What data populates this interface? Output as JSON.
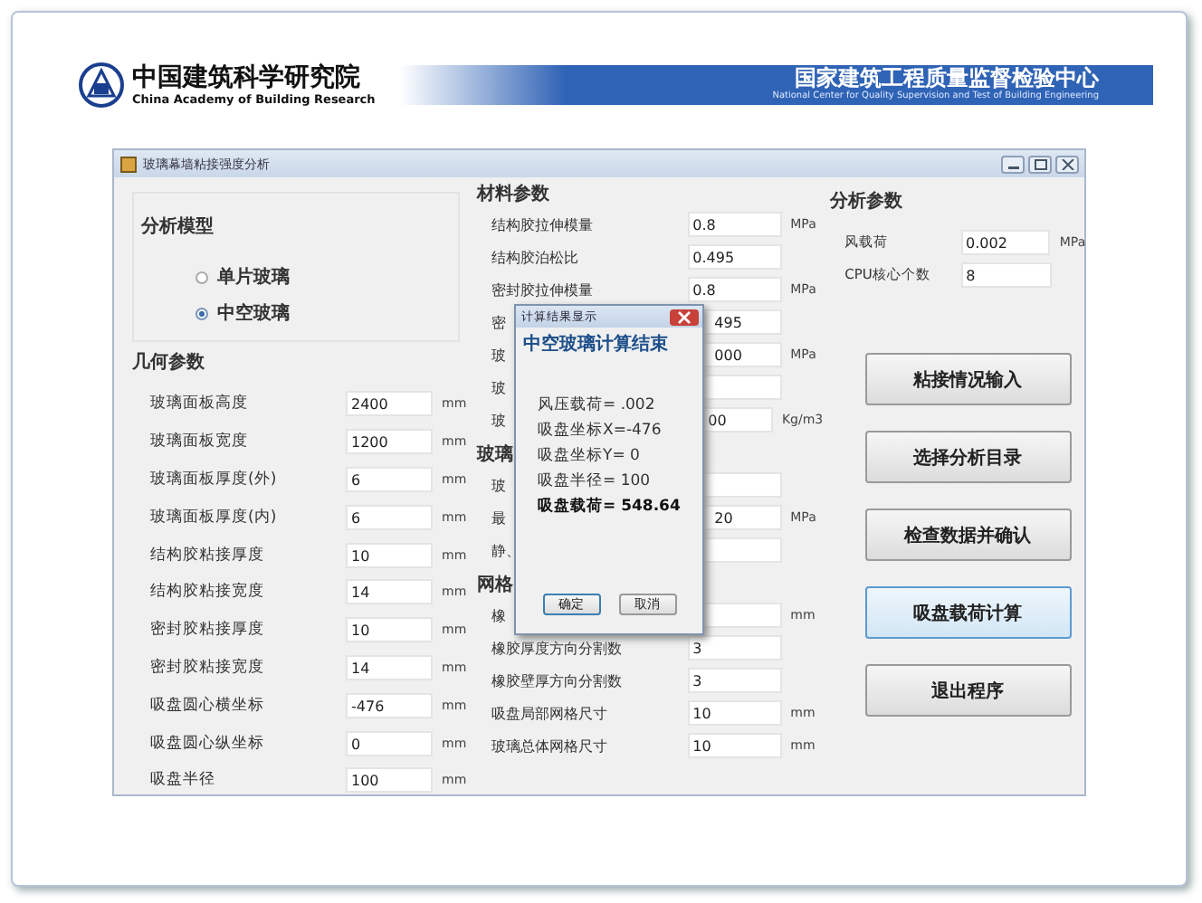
{
  "header": {
    "org_name": "中国建筑科学研究院",
    "org_name_en": "China Academy of Building Research",
    "center_name": "国家建筑工程质量监督检验中心",
    "center_name_en": "National Center for Quality Supervision and Test of Building Engineering"
  },
  "window": {
    "title": "玻璃幕墙粘接强度分析"
  },
  "analysis_model": {
    "title": "分析模型",
    "options": [
      {
        "label": "单片玻璃",
        "selected": false
      },
      {
        "label": "中空玻璃",
        "selected": true
      }
    ]
  },
  "geometry": {
    "title": "几何参数",
    "rows": [
      {
        "label": "玻璃面板高度",
        "value": "2400",
        "unit": "mm"
      },
      {
        "label": "玻璃面板宽度",
        "value": "1200",
        "unit": "mm"
      },
      {
        "label": "玻璃面板厚度(外)",
        "value": "6",
        "unit": "mm"
      },
      {
        "label": "玻璃面板厚度(内)",
        "value": "6",
        "unit": "mm"
      },
      {
        "label": "结构胶粘接厚度",
        "value": "10",
        "unit": "mm"
      },
      {
        "label": "结构胶粘接宽度",
        "value": "14",
        "unit": "mm"
      },
      {
        "label": "密封胶粘接厚度",
        "value": "10",
        "unit": "mm"
      },
      {
        "label": "密封胶粘接宽度",
        "value": "14",
        "unit": "mm"
      },
      {
        "label": "吸盘圆心横坐标",
        "value": "-476",
        "unit": "mm"
      },
      {
        "label": "吸盘圆心纵坐标",
        "value": "0",
        "unit": "mm"
      },
      {
        "label": "吸盘半径",
        "value": "100",
        "unit": "mm"
      }
    ]
  },
  "material": {
    "title": "材料参数",
    "rows": [
      {
        "kind": "full",
        "label": "结构胶拉伸模量",
        "value": "0.8",
        "unit": "MPa"
      },
      {
        "kind": "full",
        "label": "结构胶泊松比",
        "value": "0.495"
      },
      {
        "kind": "full",
        "label": "密封胶拉伸模量",
        "value": "0.8",
        "unit": "MPa"
      },
      {
        "kind": "covered",
        "label": "密",
        "value": "495"
      },
      {
        "kind": "covered",
        "label": "玻",
        "value": "000",
        "unit": "MPa"
      },
      {
        "kind": "covered",
        "label": "玻"
      },
      {
        "kind": "covered",
        "label": "玻",
        "value": "00",
        "unit": "Kg/m3"
      }
    ]
  },
  "glass": {
    "title": "玻璃",
    "rows": [
      {
        "kind": "covered",
        "label": "玻"
      },
      {
        "kind": "covered",
        "label": "最",
        "value": "20",
        "unit": "MPa"
      },
      {
        "kind": "covered",
        "label": "静、"
      }
    ]
  },
  "mesh": {
    "title": "网格",
    "rows": [
      {
        "kind": "covered",
        "label": "橡",
        "unit": "mm"
      },
      {
        "kind": "full",
        "label": "橡胶厚度方向分割数",
        "value": "3"
      },
      {
        "kind": "full",
        "label": "橡胶壁厚方向分割数",
        "value": "3"
      },
      {
        "kind": "full",
        "label": "吸盘局部网格尺寸",
        "value": "10",
        "unit": "mm"
      },
      {
        "kind": "full",
        "label": "玻璃总体网格尺寸",
        "value": "10",
        "unit": "mm"
      }
    ]
  },
  "analysis_params": {
    "title": "分析参数",
    "rows": [
      {
        "label": "风载荷",
        "value": "0.002",
        "unit": "MPa"
      },
      {
        "label": "CPU核心个数",
        "value": "8"
      }
    ]
  },
  "actions": [
    {
      "label": "粘接情况输入",
      "focused": false
    },
    {
      "label": "选择分析目录",
      "focused": false
    },
    {
      "label": "检查数据并确认",
      "focused": false
    },
    {
      "label": "吸盘载荷计算",
      "focused": true
    },
    {
      "label": "退出程序",
      "focused": false
    }
  ],
  "dialog": {
    "title": "计算结果显示",
    "heading": "中空玻璃计算结束",
    "lines": [
      {
        "text": "风压载荷= .002",
        "bold": false
      },
      {
        "text": "吸盘坐标X=-476",
        "bold": false
      },
      {
        "text": "吸盘坐标Y= 0",
        "bold": false
      },
      {
        "text": "吸盘半径= 100",
        "bold": false
      },
      {
        "text": "吸盘载荷= 548.64",
        "bold": true
      }
    ],
    "buttons": [
      {
        "label": "确定",
        "default": true
      },
      {
        "label": "取消",
        "default": false
      }
    ]
  }
}
